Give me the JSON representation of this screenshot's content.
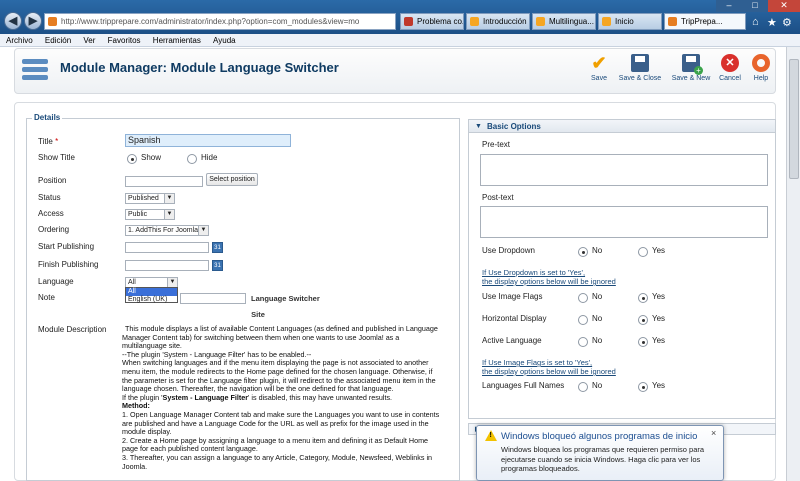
{
  "browser": {
    "address_url": "http://www.tripprepare.com/administrator/index.php?option=com_modules&view=mo",
    "address_domain": "tripprepare.com",
    "tabs": [
      {
        "label": "Problema co...",
        "color": "#c0392b"
      },
      {
        "label": "Introducción",
        "color": "#f5a623"
      },
      {
        "label": "Multilingua...",
        "color": "#f5a623"
      },
      {
        "label": "Inicio",
        "color": "#f5a623"
      },
      {
        "label": "TripPrepa...",
        "color": "#e67e22"
      }
    ],
    "menu": [
      "Archivo",
      "Edición",
      "Ver",
      "Favoritos",
      "Herramientas",
      "Ayuda"
    ]
  },
  "toolbar": {
    "title": "Module Manager: Module Language Switcher",
    "buttons": [
      {
        "name": "save",
        "label": "Save",
        "icon": "check-icon",
        "color": "#f0a000"
      },
      {
        "name": "save-close",
        "label": "Save & Close",
        "icon": "save-icon",
        "color": "#3a5f8a"
      },
      {
        "name": "save-new",
        "label": "Save & New",
        "icon": "save-new-icon",
        "color": "#3a5f8a"
      },
      {
        "name": "cancel",
        "label": "Cancel",
        "icon": "cancel-icon",
        "color": "#d9302c"
      },
      {
        "name": "help",
        "label": "Help",
        "icon": "help-icon",
        "color": "#e8642c"
      }
    ]
  },
  "details": {
    "legend": "Details",
    "title_label": "Title",
    "required_mark": "*",
    "title_value": "Spanish",
    "show_title_label": "Show Title",
    "show_label": "Show",
    "hide_label": "Hide",
    "position_label": "Position",
    "position_value": "",
    "select_position_label": "Select position",
    "status_label": "Status",
    "status_value": "Published",
    "access_label": "Access",
    "access_value": "Public",
    "ordering_label": "Ordering",
    "ordering_value": "1. AddThis For Joomla",
    "start_publishing_label": "Start Publishing",
    "finish_publishing_label": "Finish Publishing",
    "calendar_text": "31",
    "language_label": "Language",
    "language_value": "All",
    "language_options": [
      "All",
      "English (UK)"
    ],
    "note_label": "Note",
    "module_name_line1": "Language Switcher",
    "module_name_line2": "Site",
    "description_label": "Module Description",
    "description": [
      "This module displays a list of available Content Languages (as defined and published in Language Manager Content tab) for switching between them when one wants to use Joomla! as a multilanguage site.",
      "--The plugin 'System - Language Filter' has to be enabled.--",
      "When switching languages and if the menu item displaying the page is not associated to another menu item, the module redirects to the Home page defined for the chosen language. Otherwise, if the parameter is set for the Language filter plugin, it will redirect to the associated menu item in the language chosen. Thereafter, the navigation will be the one defined for that language."
    ],
    "desc_warn_pre": "If the plugin '",
    "desc_warn_bold": "System - Language Filter",
    "desc_warn_post": "' is disabled, this may have unwanted results.",
    "method_label": "Method:",
    "method_steps": [
      "1. Open Language Manager Content tab and make sure the Languages you want to use in contents are published and have a Language Code for the URL as well as prefix for the image used in the module display.",
      "2. Create a Home page by assigning a language to a menu item and defining it as Default Home page for each published content language.",
      "3. Thereafter, you can assign a language to any Article, Category, Module, Newsfeed, Weblinks in Joomla."
    ]
  },
  "basic_options": {
    "heading": "Basic Options",
    "pre_text_label": "Pre-text",
    "post_text_label": "Post-text",
    "use_dropdown_label": "Use Dropdown",
    "no_label": "No",
    "yes_label": "Yes",
    "dropdown_note_line1": "If Use Dropdown is set to 'Yes',",
    "dropdown_note_line2": "the display options below will be ignored",
    "use_image_flags_label": "Use Image Flags",
    "horizontal_display_label": "Horizontal Display",
    "active_language_label": "Active Language",
    "flags_note_line1": "If Use Image Flags is set to 'Yes',",
    "flags_note_line2": "the display options below will be ignored",
    "full_names_label": "Languages Full Names"
  },
  "notification": {
    "title": "Windows bloqueó algunos programas de inicio",
    "body": "Windows bloquea los programas que requieren permiso para ejecutarse cuando se inicia Windows. Haga clic para ver los programas bloqueados.",
    "close": "×"
  }
}
